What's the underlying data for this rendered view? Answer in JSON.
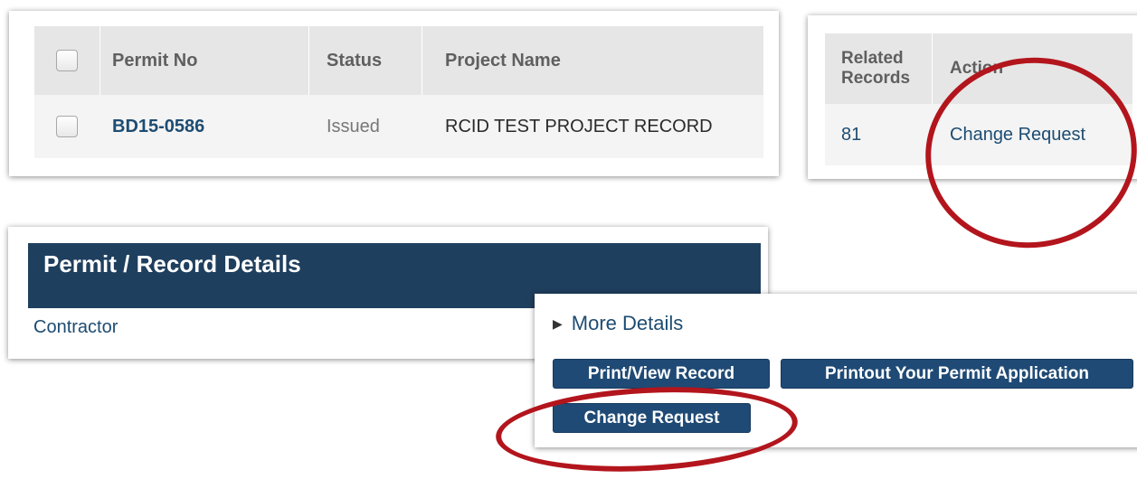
{
  "permit_table": {
    "headers": {
      "permit_no": "Permit No",
      "status": "Status",
      "project_name": "Project Name"
    },
    "rows": [
      {
        "permit_no": "BD15-0586",
        "status": "Issued",
        "project_name": "RCID TEST PROJECT RECORD"
      }
    ]
  },
  "action_table": {
    "headers": {
      "related_line1": "Related",
      "related_line2": "Records",
      "action": "Action"
    },
    "rows": [
      {
        "related_records": "81",
        "action": "Change Request"
      }
    ]
  },
  "details": {
    "title": "Permit / Record Details",
    "contractor_link": "Contractor"
  },
  "more_details": {
    "toggle_label": "More Details",
    "buttons": {
      "print_view": "Print/View Record",
      "printout": "Printout Your Permit Application",
      "change_request": "Change Request"
    }
  },
  "icons": {
    "expand": "caret-right-icon"
  },
  "colors": {
    "brand_navy": "#1f3f5e",
    "button_blue": "#1f4a75",
    "link_blue": "#1d4c72",
    "annotation_red": "#b3151d"
  }
}
